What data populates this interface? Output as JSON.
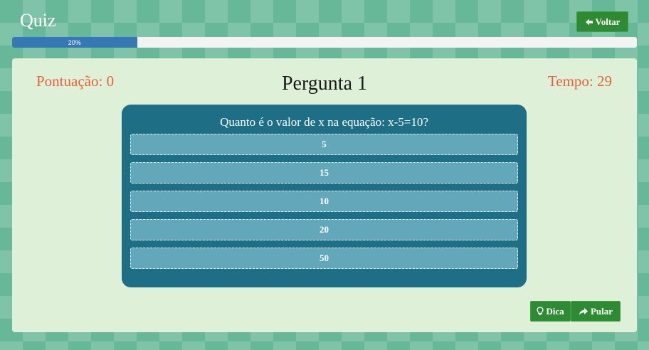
{
  "header": {
    "title": "Quiz",
    "back_label": "Voltar",
    "back_icon": "arrow-left-icon"
  },
  "progress": {
    "label": "20%",
    "value": 0.2
  },
  "stats": {
    "score_label": "Pontuação:",
    "score_value": "0",
    "question_label": "Pergunta 1",
    "timer_label": "Tempo:",
    "timer_value": "29"
  },
  "question": {
    "text": "Quanto é o valor de x na equação: x-5=10?",
    "answers": [
      "5",
      "15",
      "10",
      "20",
      "50"
    ]
  },
  "actions": {
    "hint_label": "Dica",
    "hint_icon": "lightbulb-icon",
    "skip_label": "Pular",
    "skip_icon": "share-arrow-icon"
  },
  "colors": {
    "accent_green": "#2e8b34",
    "score_orange": "#e4643a",
    "card_blue": "#1e6e86",
    "answer_blue": "#62a8ba",
    "progress_blue": "#3677b6",
    "panel_bg": "#dff0d8"
  }
}
